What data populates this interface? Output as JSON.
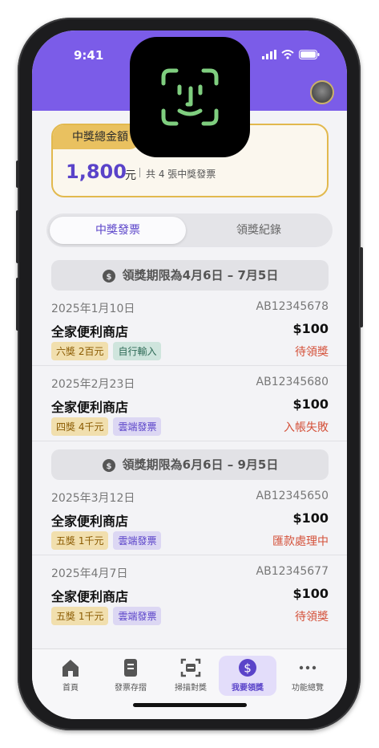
{
  "status_bar": {
    "time": "9:41"
  },
  "summary": {
    "label": "中獎總金額",
    "amount": "1,800",
    "unit": "元",
    "count_text": "共 4 張中獎發票"
  },
  "segment": {
    "active": "中獎發票",
    "other": "領獎紀錄"
  },
  "groups": [
    {
      "period": "領獎期限為4月6日 – 7月5日",
      "items": [
        {
          "date": "2025年1月10日",
          "id": "AB12345678",
          "store": "全家便利商店",
          "amount": "$100",
          "prize": "六獎 2百元",
          "source": "自行輸入",
          "status": "待領獎"
        },
        {
          "date": "2025年2月23日",
          "id": "AB12345680",
          "store": "全家便利商店",
          "amount": "$100",
          "prize": "四獎 4千元",
          "source": "雲端發票",
          "status": "入帳失敗"
        }
      ]
    },
    {
      "period": "領獎期限為6月6日 – 9月5日",
      "items": [
        {
          "date": "2025年3月12日",
          "id": "AB12345650",
          "store": "全家便利商店",
          "amount": "$100",
          "prize": "五獎 1千元",
          "source": "雲端發票",
          "status": "匯款處理中"
        },
        {
          "date": "2025年4月7日",
          "id": "AB12345677",
          "store": "全家便利商店",
          "amount": "$100",
          "prize": "五獎 1千元",
          "source": "雲端發票",
          "status": "待領獎"
        }
      ]
    }
  ],
  "tabbar": [
    {
      "label": "首頁",
      "icon": "home-icon"
    },
    {
      "label": "發票存摺",
      "icon": "receipt-icon"
    },
    {
      "label": "掃描對獎",
      "icon": "scan-icon"
    },
    {
      "label": "我要領獎",
      "icon": "dollar-icon",
      "active": true
    },
    {
      "label": "功能總覽",
      "icon": "more-icon"
    }
  ],
  "colors": {
    "primary": "#7b5ce8",
    "gold": "#e2b94e",
    "status_red": "#d4513a"
  }
}
